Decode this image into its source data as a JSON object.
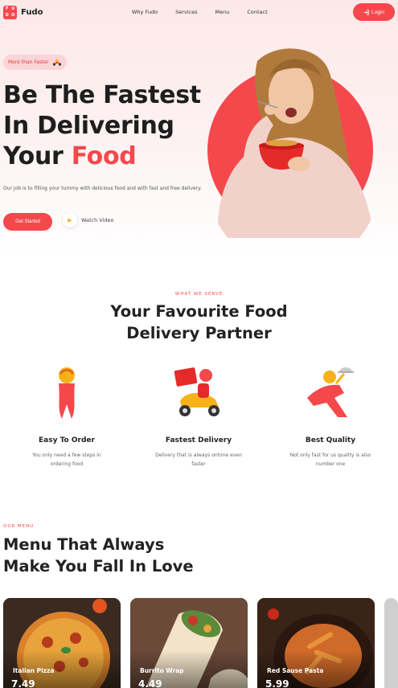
{
  "header": {
    "logo_letters": [
      "F",
      "U",
      "D",
      "O"
    ],
    "logo_text": "Fudo",
    "nav": [
      "Why Fudo",
      "Services",
      "Menu",
      "Contact"
    ],
    "login_label": "Login"
  },
  "hero": {
    "pill": "More than Faster",
    "title_line1": "Be The Fastest",
    "title_line2": "In Delivering",
    "title_line3_prefix": "Your ",
    "title_line3_accent": "Food",
    "description": "Our job is to filling your tummy with delicious food and with fast and free delivery.",
    "cta_label": "Get Started",
    "watch_label": "Watch Video"
  },
  "serve": {
    "eyebrow": "WHAT WE SERVE",
    "title_line1": "Your Favourite Food",
    "title_line2": "Delivery Partner",
    "features": [
      {
        "title": "Easy To Order",
        "desc": "You only need a few steps in ordering food"
      },
      {
        "title": "Fastest Delivery",
        "desc": "Delivery that is always ontime even faster"
      },
      {
        "title": "Best Quality",
        "desc": "Not only fast for us quality is also number one"
      }
    ]
  },
  "menu": {
    "eyebrow": "OUR MENU",
    "title_line1": "Menu That Always",
    "title_line2": "Make You Fall In Love",
    "items": [
      {
        "name": "Italian Pizza",
        "price": "7.49"
      },
      {
        "name": "Burrito Wrap",
        "price": "4.49"
      },
      {
        "name": "Red Sause Pasta",
        "price": "5.99"
      }
    ]
  },
  "colors": {
    "accent": "#f5484c",
    "pill_bg": "#fbd4d5",
    "play": "#f7b21b"
  }
}
